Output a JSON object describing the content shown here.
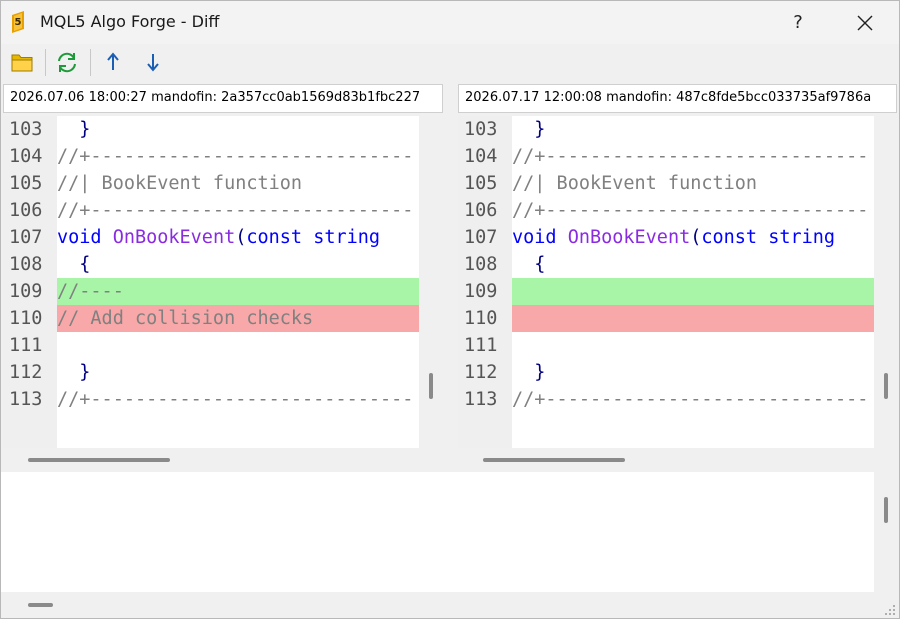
{
  "window": {
    "title": "MQL5 Algo Forge - Diff",
    "help_label": "?"
  },
  "toolbar": {
    "items": [
      "folder-icon",
      "refresh-icon",
      "arrow-up-icon",
      "arrow-down-icon"
    ]
  },
  "left": {
    "header": "2026.07.06 18:00:27 mandofin: 2a357cc0ab1569d83b1fbc227",
    "lines": [
      {
        "num": "103",
        "code": "  }",
        "kind": "plain",
        "diff": ""
      },
      {
        "num": "104",
        "code": "//+-----------------------------",
        "kind": "comment",
        "diff": ""
      },
      {
        "num": "105",
        "code": "//| BookEvent function",
        "kind": "comment",
        "diff": ""
      },
      {
        "num": "106",
        "code": "//+-----------------------------",
        "kind": "comment",
        "diff": ""
      },
      {
        "num": "107",
        "code": "void OnBookEvent(const string",
        "kind": "signature",
        "diff": ""
      },
      {
        "num": "108",
        "code": "  {",
        "kind": "plain",
        "diff": ""
      },
      {
        "num": "109",
        "code": "//----",
        "kind": "comment",
        "diff": "added"
      },
      {
        "num": "110",
        "code": "// Add collision checks",
        "kind": "comment",
        "diff": "removed"
      },
      {
        "num": "111",
        "code": "",
        "kind": "plain",
        "diff": ""
      },
      {
        "num": "112",
        "code": "  }",
        "kind": "plain",
        "diff": ""
      },
      {
        "num": "113",
        "code": "//+-----------------------------",
        "kind": "comment",
        "diff": ""
      }
    ]
  },
  "right": {
    "header": "2026.07.17 12:00:08 mandofin: 487c8fde5bcc033735af9786a",
    "lines": [
      {
        "num": "103",
        "code": "  }",
        "kind": "plain",
        "diff": ""
      },
      {
        "num": "104",
        "code": "//+-----------------------------",
        "kind": "comment",
        "diff": ""
      },
      {
        "num": "105",
        "code": "//| BookEvent function",
        "kind": "comment",
        "diff": ""
      },
      {
        "num": "106",
        "code": "//+-----------------------------",
        "kind": "comment",
        "diff": ""
      },
      {
        "num": "107",
        "code": "void OnBookEvent(const string",
        "kind": "signature",
        "diff": ""
      },
      {
        "num": "108",
        "code": "  {",
        "kind": "plain",
        "diff": ""
      },
      {
        "num": "109",
        "code": "",
        "kind": "plain",
        "diff": "added"
      },
      {
        "num": "110",
        "code": "",
        "kind": "plain",
        "diff": "removed"
      },
      {
        "num": "111",
        "code": "",
        "kind": "plain",
        "diff": ""
      },
      {
        "num": "112",
        "code": "  }",
        "kind": "plain",
        "diff": ""
      },
      {
        "num": "113",
        "code": "//+-----------------------------",
        "kind": "comment",
        "diff": ""
      }
    ]
  },
  "colors": {
    "added": "#a8f5a8",
    "removed": "#f8a8a8",
    "keyword": "#0000ff",
    "function": "#8a2be2",
    "comment": "#808080",
    "punct": "#000080"
  }
}
